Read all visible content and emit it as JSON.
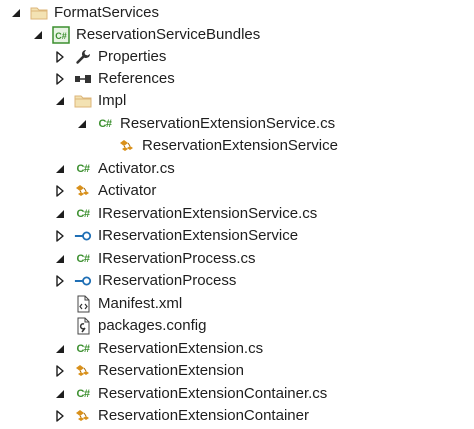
{
  "tree": {
    "items": [
      {
        "label": "FormatServices",
        "icon": "folder-icon",
        "expander": "expanded"
      },
      {
        "label": "ReservationServiceBundles",
        "icon": "csharp-project-icon",
        "expander": "expanded"
      },
      {
        "label": "Properties",
        "icon": "wrench-icon",
        "expander": "collapsed"
      },
      {
        "label": "References",
        "icon": "references-icon",
        "expander": "collapsed"
      },
      {
        "label": "Impl",
        "icon": "folder-icon",
        "expander": "expanded"
      },
      {
        "label": "ReservationExtensionService.cs",
        "icon": "csharp-file-icon",
        "expander": "expanded"
      },
      {
        "label": "ReservationExtensionService",
        "icon": "class-icon",
        "expander": "none"
      },
      {
        "label": "Activator.cs",
        "icon": "csharp-file-icon",
        "expander": "expanded"
      },
      {
        "label": "Activator",
        "icon": "class-icon",
        "expander": "collapsed"
      },
      {
        "label": "IReservationExtensionService.cs",
        "icon": "csharp-file-icon",
        "expander": "expanded"
      },
      {
        "label": "IReservationExtensionService",
        "icon": "interface-icon",
        "expander": "collapsed"
      },
      {
        "label": "IReservationProcess.cs",
        "icon": "csharp-file-icon",
        "expander": "expanded"
      },
      {
        "label": "IReservationProcess",
        "icon": "interface-icon",
        "expander": "collapsed"
      },
      {
        "label": "Manifest.xml",
        "icon": "xml-file-icon",
        "expander": "none"
      },
      {
        "label": "packages.config",
        "icon": "config-file-icon",
        "expander": "none"
      },
      {
        "label": "ReservationExtension.cs",
        "icon": "csharp-file-icon",
        "expander": "expanded"
      },
      {
        "label": "ReservationExtension",
        "icon": "class-icon",
        "expander": "collapsed"
      },
      {
        "label": "ReservationExtensionContainer.cs",
        "icon": "csharp-file-icon",
        "expander": "expanded"
      },
      {
        "label": "ReservationExtensionContainer",
        "icon": "class-icon",
        "expander": "collapsed"
      }
    ]
  },
  "colors": {
    "text": "#1e1e1e",
    "arrow": "#1e1e1e",
    "csharp_green": "#3b8f2e",
    "class_orange": "#d9901a",
    "interface_blue": "#1f6fb5",
    "folder": "#dcb67a"
  }
}
